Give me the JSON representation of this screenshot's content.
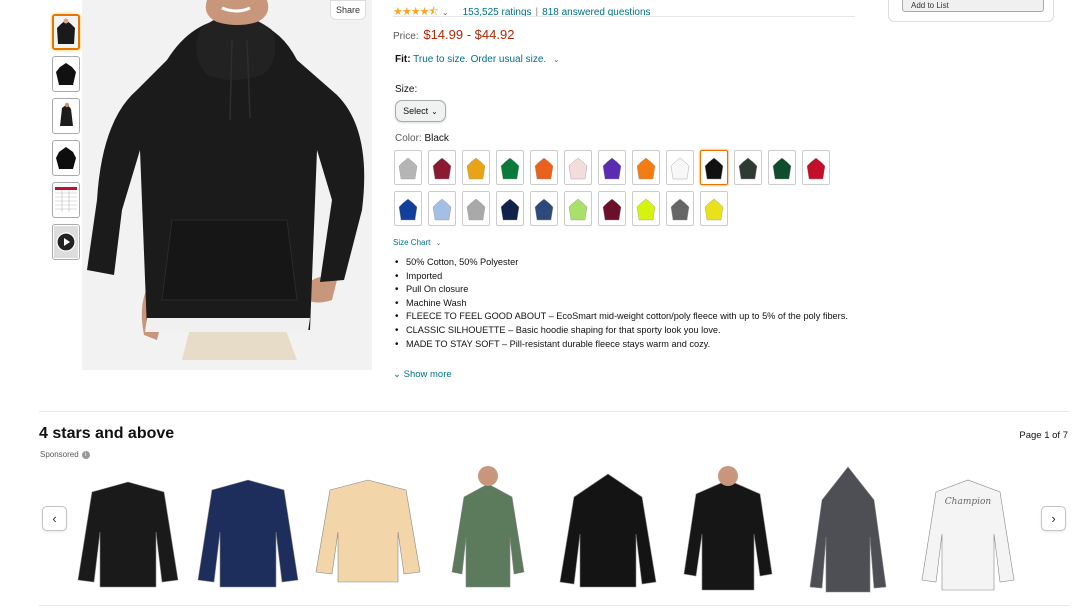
{
  "share_label": "Share",
  "add_list_label": "Add to List",
  "rating": {
    "stars": "★★★★⯪",
    "count": "153,525 ratings",
    "separator": "|",
    "questions": "818 answered questions"
  },
  "price": {
    "label": "Price:",
    "value": "$14.99 - $44.92"
  },
  "fit": {
    "label": "Fit:",
    "value": "True to size. Order usual size."
  },
  "size": {
    "label": "Size:",
    "select_value": "Select"
  },
  "color": {
    "label": "Color:",
    "selected": "Black"
  },
  "swatches": [
    {
      "name": "swatch-grey",
      "color": "#b5b5b5"
    },
    {
      "name": "swatch-maroon",
      "color": "#8b1a33"
    },
    {
      "name": "swatch-gold",
      "color": "#e8a317"
    },
    {
      "name": "swatch-green",
      "color": "#0a7a3a"
    },
    {
      "name": "swatch-orange",
      "color": "#e8611d"
    },
    {
      "name": "swatch-pale-pink",
      "color": "#f2dcdc"
    },
    {
      "name": "swatch-purple",
      "color": "#5a2db0"
    },
    {
      "name": "swatch-safety-orange",
      "color": "#f57c12"
    },
    {
      "name": "swatch-white",
      "color": "#f7f7f7"
    },
    {
      "name": "swatch-black",
      "color": "#111111"
    },
    {
      "name": "swatch-charcoal",
      "color": "#2f3a33"
    },
    {
      "name": "swatch-dark-green",
      "color": "#0f4d2e"
    },
    {
      "name": "swatch-red",
      "color": "#c2102a"
    },
    {
      "name": "swatch-royal-blue",
      "color": "#123e9c"
    },
    {
      "name": "swatch-light-blue",
      "color": "#a3bfe6"
    },
    {
      "name": "swatch-light-steel",
      "color": "#a9a9a9"
    },
    {
      "name": "swatch-navy",
      "color": "#10214a"
    },
    {
      "name": "swatch-slate-blue",
      "color": "#2d4a7a"
    },
    {
      "name": "swatch-lime",
      "color": "#a8e06a"
    },
    {
      "name": "swatch-cardinal",
      "color": "#6b0f2a"
    },
    {
      "name": "swatch-safety-green",
      "color": "#d6f20f"
    },
    {
      "name": "swatch-smoke-grey",
      "color": "#666666"
    },
    {
      "name": "swatch-yellow",
      "color": "#e9e21a"
    }
  ],
  "selected_swatch": "swatch-black",
  "size_chart": "Size Chart",
  "bullets": [
    "50% Cotton, 50% Polyester",
    "Imported",
    "Pull On closure",
    "Machine Wash",
    "FLEECE TO FEEL GOOD ABOUT – EcoSmart mid-weight cotton/poly fleece with up to 5% of the poly fibers.",
    "CLASSIC SILHOUETTE – Basic hoodie shaping for that sporty look you love.",
    "MADE TO STAY SOFT – Pill-resistant durable fleece stays warm and cozy."
  ],
  "show_more": "Show more",
  "carousel": {
    "title": "4 stars and above",
    "sponsored": "Sponsored",
    "info_icon": "i",
    "page": "Page 1 of 7",
    "prev_icon": "‹",
    "next_icon": "›",
    "items": [
      {
        "name": "black-sweatshirt",
        "color": "#1a1a1a"
      },
      {
        "name": "navy-plaid-sweater",
        "color": "#1e2e5c"
      },
      {
        "name": "beige-fleece-sweatshirt",
        "color": "#f2d5a8"
      },
      {
        "name": "olive-hoodie-model",
        "color": "#5c7a5c"
      },
      {
        "name": "black-hoodie",
        "color": "#141414"
      },
      {
        "name": "black-hoodie-model",
        "color": "#161616"
      },
      {
        "name": "grey-zip-hoodie",
        "color": "#4d4f55"
      },
      {
        "name": "white-champion-sweatshirt",
        "color": "#f4f4f4"
      }
    ],
    "brand_text": "Champion"
  }
}
